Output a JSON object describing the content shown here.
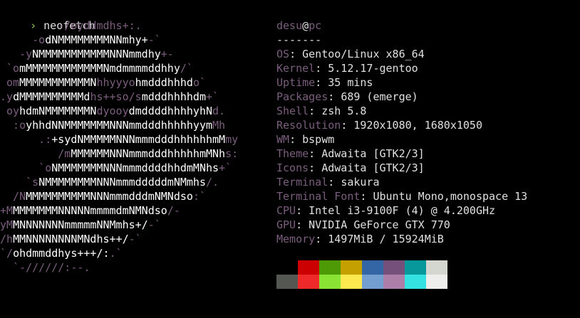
{
  "prompt": {
    "symbol": "›",
    "command": "neofetch"
  },
  "colors": {
    "primary": "#7b5d7e",
    "text": "#e0e0e0",
    "prompt": "#8fd14f",
    "background": "#000000"
  },
  "logo": [
    [
      {
        "t": "         -/oyddmdhs+:.",
        "c": "p"
      }
    ],
    [
      {
        "t": "     -o",
        "c": "p"
      },
      {
        "t": "dNMMMMMMMMNNmhy+",
        "c": "w"
      },
      {
        "t": "-`",
        "c": "p"
      }
    ],
    [
      {
        "t": "   -y",
        "c": "p"
      },
      {
        "t": "NMMMMMMMMMMMNNNmmdhy",
        "c": "w"
      },
      {
        "t": "+-",
        "c": "p"
      }
    ],
    [
      {
        "t": " `o",
        "c": "p"
      },
      {
        "t": "mMMMMMMMMMMMMNmdmmmmddhhy",
        "c": "w"
      },
      {
        "t": "/`",
        "c": "p"
      }
    ],
    [
      {
        "t": " om",
        "c": "p"
      },
      {
        "t": "MMMMMMMMMMMN",
        "c": "w"
      },
      {
        "t": "hhyyyo",
        "c": "p"
      },
      {
        "t": "hmdddhhhd",
        "c": "w"
      },
      {
        "t": "o`",
        "c": "p"
      }
    ],
    [
      {
        "t": ".y",
        "c": "p"
      },
      {
        "t": "dMMMMMMMMMMd",
        "c": "w"
      },
      {
        "t": "hs++so/s",
        "c": "p"
      },
      {
        "t": "mdddhhhhdm",
        "c": "w"
      },
      {
        "t": "+`",
        "c": "p"
      }
    ],
    [
      {
        "t": " oy",
        "c": "p"
      },
      {
        "t": "hdmNMMMMMMMN",
        "c": "w"
      },
      {
        "t": "dyooy",
        "c": "p"
      },
      {
        "t": "dmddddhhhhyhN",
        "c": "w"
      },
      {
        "t": "d.",
        "c": "p"
      }
    ],
    [
      {
        "t": "  :o",
        "c": "p"
      },
      {
        "t": "yhhdNNMMMMMMMNNNmmdddhhhhhyym",
        "c": "w"
      },
      {
        "t": "Mh",
        "c": "p"
      }
    ],
    [
      {
        "t": "      .:",
        "c": "p"
      },
      {
        "t": "+sydNMMMMMNNNmmmdddhhhhhhmM",
        "c": "w"
      },
      {
        "t": "my",
        "c": "p"
      }
    ],
    [
      {
        "t": "         /m",
        "c": "p"
      },
      {
        "t": "MMMMMMNNNmmmdddhhhhhmMNh",
        "c": "w"
      },
      {
        "t": "s:",
        "c": "p"
      }
    ],
    [
      {
        "t": "      `o",
        "c": "p"
      },
      {
        "t": "NMMMMMMMNNNmmmddddhhdmMNhs",
        "c": "w"
      },
      {
        "t": "+`",
        "c": "p"
      }
    ],
    [
      {
        "t": "    `s",
        "c": "p"
      },
      {
        "t": "NMMMMMMMMNNNmmmdddddmNMmhs",
        "c": "w"
      },
      {
        "t": "/.",
        "c": "p"
      }
    ],
    [
      {
        "t": "  /N",
        "c": "p"
      },
      {
        "t": "MMMMMMMMMMNNNmmmdddmNMNdso",
        "c": "w"
      },
      {
        "t": ":`",
        "c": "p"
      }
    ],
    [
      {
        "t": "+M",
        "c": "p"
      },
      {
        "t": "MMMMMMMNNNNNmmmmdmNMNdso",
        "c": "w"
      },
      {
        "t": "/-",
        "c": "p"
      }
    ],
    [
      {
        "t": "yM",
        "c": "p"
      },
      {
        "t": "MNNNNNNNmmmmmNNMmhs+/",
        "c": "w"
      },
      {
        "t": "-`",
        "c": "p"
      }
    ],
    [
      {
        "t": "/h",
        "c": "p"
      },
      {
        "t": "MMNNNNNNNNMNdhs++/",
        "c": "w"
      },
      {
        "t": "-`",
        "c": "p"
      }
    ],
    [
      {
        "t": "`/",
        "c": "p"
      },
      {
        "t": "ohdmmddhys+++/:",
        "c": "w"
      },
      {
        "t": ".`",
        "c": "p"
      }
    ],
    [
      {
        "t": "  `-//////:--.",
        "c": "p"
      }
    ]
  ],
  "info": {
    "user": "desu",
    "at": "@",
    "host": "pc",
    "separator": "-------",
    "rows": [
      {
        "key": "OS",
        "value": "Gentoo/Linux x86_64"
      },
      {
        "key": "Kernel",
        "value": "5.12.17-gentoo"
      },
      {
        "key": "Uptime",
        "value": "35 mins"
      },
      {
        "key": "Packages",
        "value": "689 (emerge)"
      },
      {
        "key": "Shell",
        "value": "zsh 5.8"
      },
      {
        "key": "Resolution",
        "value": "1920x1080, 1680x1050"
      },
      {
        "key": "WM",
        "value": "bspwm"
      },
      {
        "key": "Theme",
        "value": "Adwaita [GTK2/3]"
      },
      {
        "key": "Icons",
        "value": "Adwaita [GTK2/3]"
      },
      {
        "key": "Terminal",
        "value": "sakura"
      },
      {
        "key": "Terminal Font",
        "value": "Ubuntu Mono,monospace 13"
      },
      {
        "key": "CPU",
        "value": "Intel i3-9100F (4) @ 4.200GHz"
      },
      {
        "key": "GPU",
        "value": "NVIDIA GeForce GTX 770"
      },
      {
        "key": "Memory",
        "value": "1497MiB / 15924MiB"
      }
    ]
  },
  "palette": {
    "normal": [
      "#000000",
      "#cc0000",
      "#4e9a06",
      "#c4a000",
      "#3465a4",
      "#75507b",
      "#06989a",
      "#d3d7cf"
    ],
    "bright": [
      "#555753",
      "#ef2929",
      "#8ae234",
      "#fce94f",
      "#729fcf",
      "#ad7fa8",
      "#34e2e2",
      "#eeeeec"
    ]
  }
}
